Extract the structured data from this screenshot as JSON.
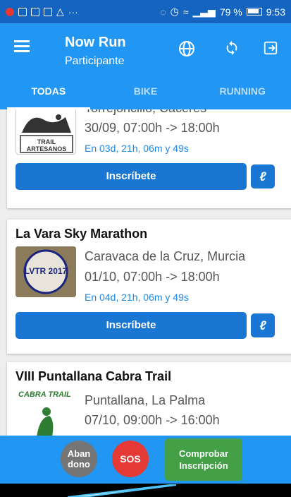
{
  "status_bar": {
    "battery": "79 %",
    "time": "9:53"
  },
  "app_bar": {
    "title": "Now Run",
    "subtitle": "Participante"
  },
  "tabs": [
    {
      "label": "TODAS",
      "active": true
    },
    {
      "label": "BIKE",
      "active": false
    },
    {
      "label": "RUNNING",
      "active": false
    }
  ],
  "events": [
    {
      "location": "Torrejoncillo, Cáceres",
      "date": "30/09, 07:00h -> 18:00h",
      "countdown": "En 03d, 21h, 06m y 49s",
      "button": "Inscríbete",
      "logo_text": "TRAIL ARTESANOS"
    },
    {
      "title": "La Vara Sky Marathon",
      "location": "Caravaca de la Cruz, Murcia",
      "date": "01/10, 07:00h -> 18:00h",
      "countdown": "En 04d, 21h, 06m y 49s",
      "button": "Inscríbete",
      "logo_text": "LVTR 2017"
    },
    {
      "title": "VIII Puntallana Cabra Trail",
      "location": "Puntallana, La Palma",
      "date": "07/10, 09:00h -> 16:00h",
      "logo_text": "CABRA TRAIL"
    }
  ],
  "bottom_bar": {
    "abandono": "Aban dono",
    "sos": "SOS",
    "comprobar": "Comprobar Inscripción"
  },
  "colors": {
    "primary": "#2196f3",
    "status": "#1565c0",
    "button": "#1976d2",
    "green": "#43a047",
    "red": "#e53935"
  }
}
